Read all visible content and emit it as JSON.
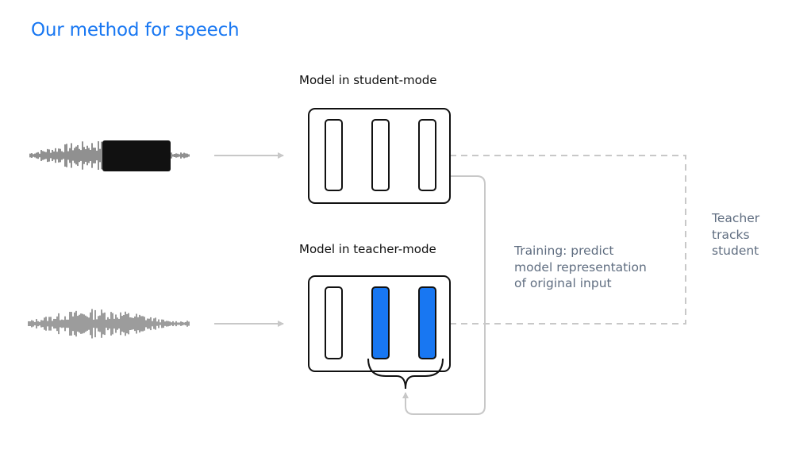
{
  "title": "Our method for speech",
  "student": {
    "label": "Model in student-mode",
    "input": "masked-waveform",
    "blocks": 3
  },
  "teacher": {
    "label": "Model in teacher-mode",
    "input": "original-waveform",
    "blocks": 3,
    "highlighted_blocks": [
      2,
      3
    ]
  },
  "annotations": {
    "training": [
      "Training: predict",
      "model representation",
      "of original input"
    ],
    "tracking": [
      "Teacher",
      "tracks",
      "student"
    ]
  },
  "colors": {
    "accent": "#1877f2",
    "block_fill": "#1877f2",
    "mask": "#111111",
    "arrow": "#c8c8c8",
    "annotation_text": "#5f6d80"
  }
}
